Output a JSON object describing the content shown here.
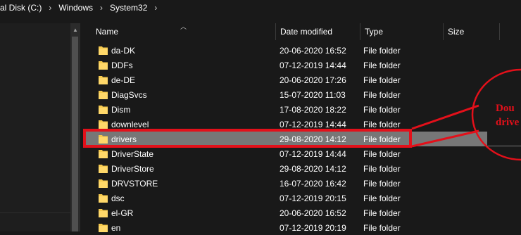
{
  "breadcrumb": {
    "items": [
      "al Disk (C:)",
      "Windows",
      "System32"
    ],
    "separator": "›"
  },
  "columns": {
    "name": "Name",
    "date_modified": "Date modified",
    "type": "Type",
    "size": "Size"
  },
  "rows": [
    {
      "name": "da-DK",
      "date": "20-06-2020 16:52",
      "type": "File folder"
    },
    {
      "name": "DDFs",
      "date": "07-12-2019 14:44",
      "type": "File folder"
    },
    {
      "name": "de-DE",
      "date": "20-06-2020 17:26",
      "type": "File folder"
    },
    {
      "name": "DiagSvcs",
      "date": "15-07-2020 11:03",
      "type": "File folder"
    },
    {
      "name": "Dism",
      "date": "17-08-2020 18:22",
      "type": "File folder"
    },
    {
      "name": "downlevel",
      "date": "07-12-2019 14:44",
      "type": "File folder"
    },
    {
      "name": "drivers",
      "date": "29-08-2020 14:12",
      "type": "File folder",
      "selected": true
    },
    {
      "name": "DriverState",
      "date": "07-12-2019 14:44",
      "type": "File folder"
    },
    {
      "name": "DriverStore",
      "date": "29-08-2020 14:12",
      "type": "File folder"
    },
    {
      "name": "DRVSTORE",
      "date": "16-07-2020 16:42",
      "type": "File folder"
    },
    {
      "name": "dsc",
      "date": "07-12-2019 20:15",
      "type": "File folder"
    },
    {
      "name": "el-GR",
      "date": "20-06-2020 16:52",
      "type": "File folder"
    },
    {
      "name": "en",
      "date": "07-12-2019 20:19",
      "type": "File folder"
    }
  ],
  "annotation": {
    "line1": "Dou",
    "line2": "drive",
    "color": "#e3101a"
  },
  "colors": {
    "background": "#191919",
    "selected_row": "#777777",
    "folder": "#f5c94d",
    "annotation": "#e3101a"
  }
}
